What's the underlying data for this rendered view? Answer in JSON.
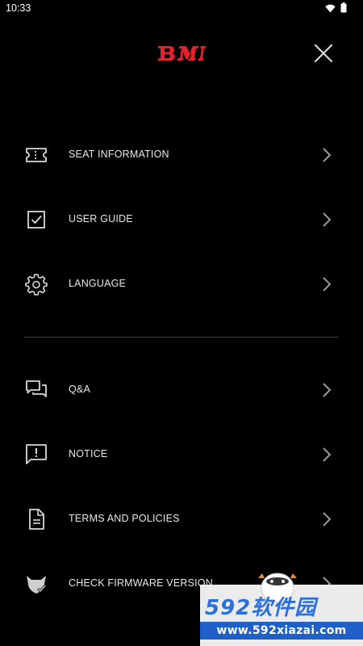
{
  "status_bar": {
    "time": "10:33",
    "icons": [
      "wifi-icon",
      "battery-icon"
    ]
  },
  "header": {
    "logo_text": "BM",
    "logo_color": "#e3202b",
    "close_icon": "close-icon"
  },
  "menu": {
    "group1": [
      {
        "label": "SEAT INFORMATION",
        "icon": "ticket-icon"
      },
      {
        "label": "USER GUIDE",
        "icon": "checkbox-icon"
      },
      {
        "label": "LANGUAGE",
        "icon": "gear-icon"
      }
    ],
    "group2": [
      {
        "label": "Q&A",
        "icon": "chat-bubbles-icon"
      },
      {
        "label": "NOTICE",
        "icon": "alert-message-icon"
      },
      {
        "label": "TERMS AND POLICIES",
        "icon": "document-icon"
      },
      {
        "label": "CHECK FIRMWARE VERSION",
        "icon": "firmware-check-icon"
      }
    ]
  },
  "watermark": {
    "title": "592软件园",
    "url": "www.592xiazai.com"
  },
  "colors": {
    "background": "#000000",
    "text": "#e8e8e8",
    "icon": "#d9d9d9",
    "chevron": "#9a9a9a",
    "divider": "#3a3a3a"
  }
}
